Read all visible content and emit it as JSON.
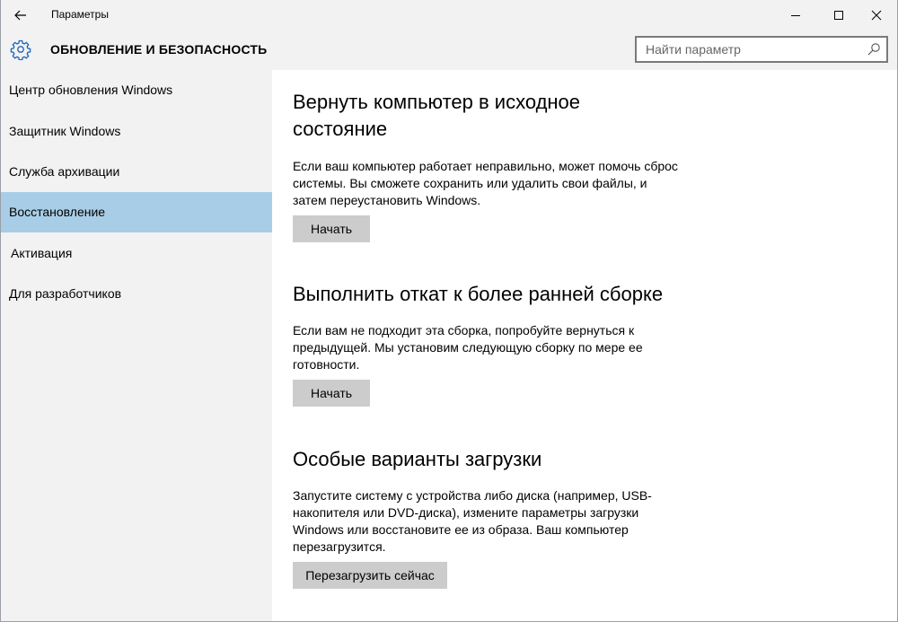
{
  "window": {
    "app_title": "Параметры",
    "back_icon": "back-arrow-icon",
    "minimize_icon": "minimize-icon",
    "maximize_icon": "maximize-icon",
    "close_icon": "close-icon"
  },
  "header": {
    "icon": "gear-icon",
    "title": "ОБНОВЛЕНИЕ И БЕЗОПАСНОСТЬ",
    "search": {
      "placeholder": "Найти параметр",
      "value": "",
      "icon": "search-icon"
    }
  },
  "sidebar": {
    "active_color": "#a8cde6",
    "items": [
      {
        "label": "Центр обновления Windows",
        "active": false
      },
      {
        "label": "Защитник Windows",
        "active": false
      },
      {
        "label": "Служба архивации",
        "active": false
      },
      {
        "label": "Восстановление",
        "active": true
      },
      {
        "label": "Активация",
        "active": false
      },
      {
        "label": "Для разработчиков",
        "active": false
      }
    ]
  },
  "sections": [
    {
      "title": "Вернуть компьютер в исходное состояние",
      "text": "Если ваш компьютер работает неправильно, может помочь сброс системы. Вы сможете сохранить или удалить свои файлы, и затем переустановить Windows.",
      "button": "Начать"
    },
    {
      "title": "Выполнить откат к более ранней сборке",
      "text": "Если вам не подходит эта сборка, попробуйте вернуться к предыдущей. Мы установим следующую сборку по мере ее готовности.",
      "button": "Начать"
    },
    {
      "title": "Особые варианты загрузки",
      "text": "Запустите систему с устройства либо диска (например, USB-накопителя или DVD-диска), измените параметры загрузки Windows или восстановите ее из образа. Ваш компьютер перезагрузится.",
      "button": "Перезагрузить сейчас"
    }
  ]
}
